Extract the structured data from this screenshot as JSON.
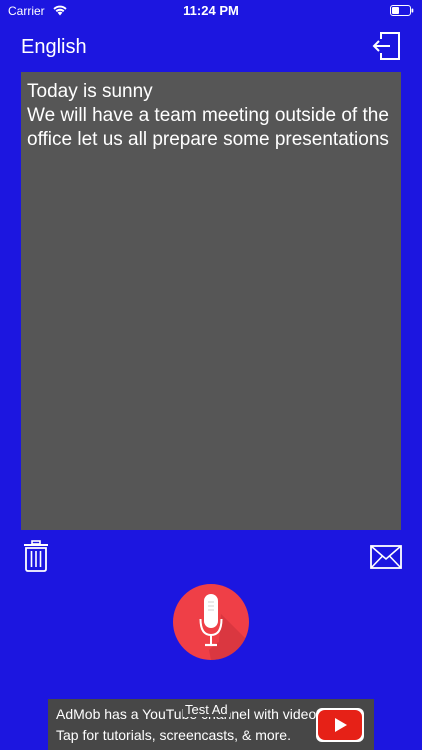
{
  "status_bar": {
    "carrier": "Carrier",
    "time": "11:24 PM"
  },
  "header": {
    "language": "English"
  },
  "transcript": {
    "text": "Today is sunny\nWe will have a team meeting outside of the office let us all prepare some presentations"
  },
  "ad": {
    "line1": "AdMob has a YouTube channel with videos!",
    "line2": "Tap for tutorials, screencasts, & more.",
    "test_label": "Test Ad"
  },
  "colors": {
    "background": "#1c16e0",
    "text_panel": "#565656",
    "mic_button": "#ef3f47",
    "ad_background": "#474747",
    "youtube_red": "#e62117"
  },
  "icons": {
    "exit": "exit-icon",
    "trash": "trash-icon",
    "mail": "mail-icon",
    "mic": "microphone-icon",
    "youtube": "youtube-icon"
  }
}
